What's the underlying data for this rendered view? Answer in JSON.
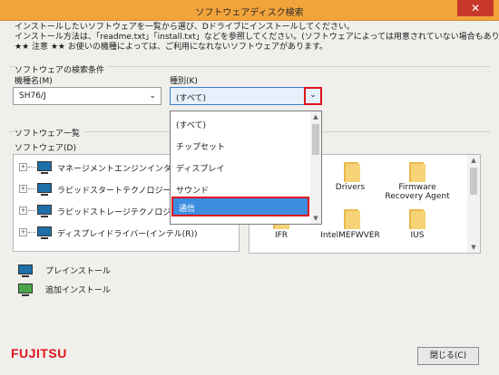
{
  "window": {
    "title": "ソフトウェアディスク検索",
    "close": "✕"
  },
  "intro": [
    "インストールしたいソフトウェアを一覧から選び、Dドライブにインストールしてください。",
    "インストール方法は、「readme.txt」「install.txt」などを参照してください。(ソフトウェアによっては用意されていない場合もあります)",
    "★★ 注意 ★★ お使いの機種によっては、ご利用になれないソフトウェアがあります。"
  ],
  "search": {
    "section_label": "ソフトウェアの検索条件",
    "model_label": "機種名(M)",
    "model_value": "SH76/J",
    "type_label": "種別(K)",
    "type_value": "(すべて)",
    "arrow": "⌄"
  },
  "list_section": "ソフトウェア一覧",
  "software_label": "ソフトウェア(D)",
  "tree": [
    "マネージメントエンジンインター",
    "ラピッドスタートテクノロジー(イン",
    "ラピッドストレージテクノロジー(イ",
    "ディスプレイドライバー(インテル(R))"
  ],
  "folders": [
    {
      "name": "Drivers"
    },
    {
      "name": "Firmware\nRecovery Agent"
    },
    {
      "name": "IFR"
    },
    {
      "name": "IntelMEFWVER"
    },
    {
      "name": "IUS"
    }
  ],
  "dropdown": {
    "items": [
      "(すべて)",
      "チップセット",
      "ディスプレイ",
      "サウンド"
    ],
    "selected": "通信"
  },
  "legend": {
    "preinstall": "プレインストール",
    "addinstall": "追加インストール"
  },
  "brand": "FUJITSU",
  "footer": {
    "close_button": "閉じる(C)"
  }
}
